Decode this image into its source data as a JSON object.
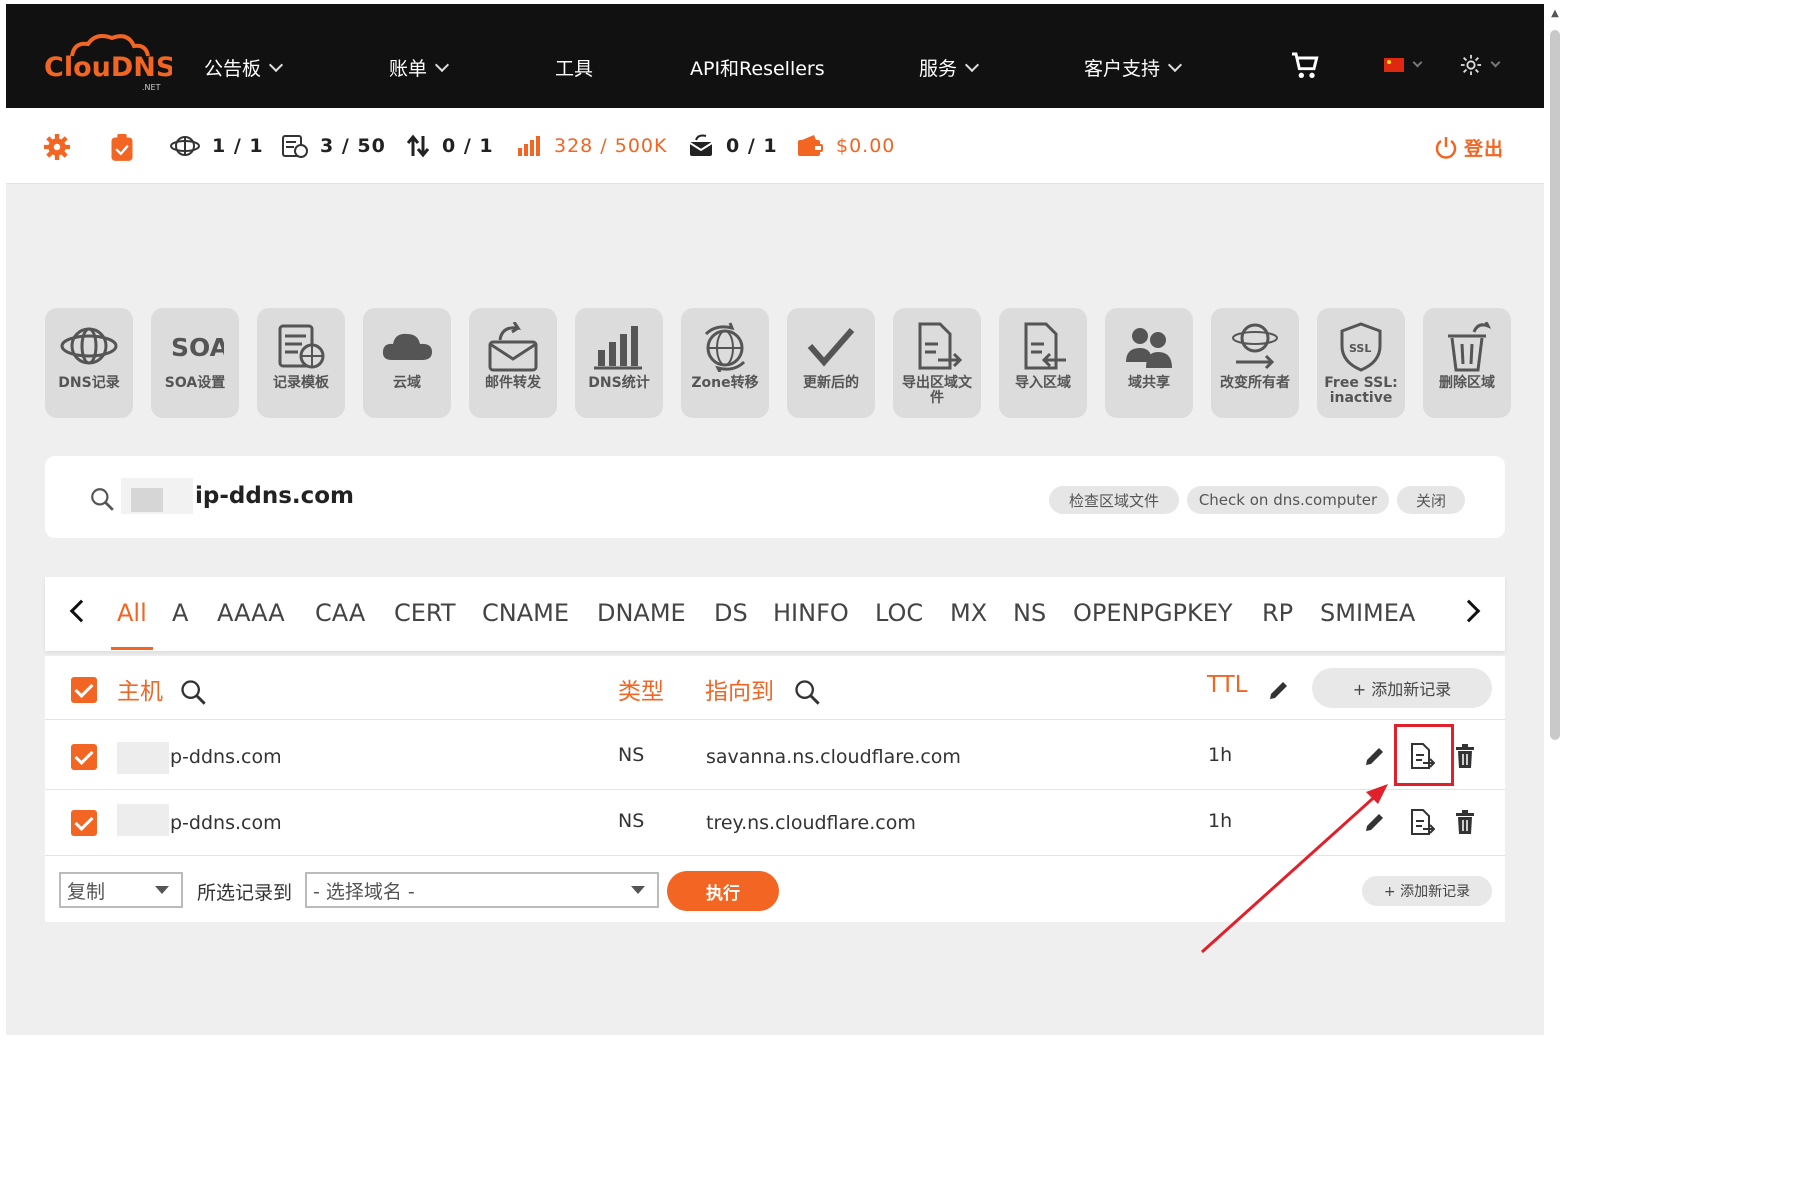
{
  "brand": {
    "name": "ClouDNS",
    "tld": ".NET"
  },
  "nav": {
    "items": [
      {
        "label": "公告板",
        "has_dropdown": true
      },
      {
        "label": "账单",
        "has_dropdown": true
      },
      {
        "label": "工具",
        "has_dropdown": false
      },
      {
        "label": "API和Resellers",
        "has_dropdown": false
      },
      {
        "label": "服务",
        "has_dropdown": true
      },
      {
        "label": "客户支持",
        "has_dropdown": true
      }
    ],
    "icons": [
      "cart-icon",
      "flag-cn-icon",
      "settings-sun-icon"
    ]
  },
  "stats": {
    "zones": "1 / 1",
    "records": "3 / 50",
    "transfers": "0 / 1",
    "queries": "328 / 500K",
    "mail": "0 / 1",
    "balance": "$0.00",
    "logout": "登出"
  },
  "tools": [
    {
      "label": "DNS记录",
      "icon": "globe-icon"
    },
    {
      "label": "SOA设置",
      "icon": "soa-icon"
    },
    {
      "label": "记录模板",
      "icon": "template-icon"
    },
    {
      "label": "云域",
      "icon": "cloud-icon"
    },
    {
      "label": "邮件转发",
      "icon": "mail-forward-icon"
    },
    {
      "label": "DNS统计",
      "icon": "bar-chart-icon"
    },
    {
      "label": "Zone转移",
      "icon": "zone-transfer-icon"
    },
    {
      "label": "更新后的",
      "icon": "check-icon"
    },
    {
      "label": "导出区域文件",
      "icon": "export-file-icon"
    },
    {
      "label": "导入区域",
      "icon": "import-file-icon"
    },
    {
      "label": "域共享",
      "icon": "users-icon"
    },
    {
      "label": "改变所有者",
      "icon": "change-owner-icon"
    },
    {
      "label": "Free SSL: inactive",
      "icon": "ssl-shield-icon"
    },
    {
      "label": "删除区域",
      "icon": "delete-bin-icon"
    }
  ],
  "domain": {
    "name": "ip-ddns.com",
    "actions": [
      "检查区域文件",
      "Check on dns.computer",
      "关闭"
    ]
  },
  "record_types": [
    "All",
    "A",
    "AAAA",
    "CAA",
    "CERT",
    "CNAME",
    "DNAME",
    "DS",
    "HINFO",
    "LOC",
    "MX",
    "NS",
    "OPENPGPKEY",
    "RP",
    "SMIMEA"
  ],
  "active_type": "All",
  "table": {
    "headers": {
      "host": "主机",
      "type": "类型",
      "points_to": "指向到",
      "ttl": "TTL"
    },
    "add_label": "+ 添加新记录",
    "rows": [
      {
        "host": "p-ddns.com",
        "type": "NS",
        "points_to": "savanna.ns.cloudflare.com",
        "ttl": "1h"
      },
      {
        "host": "p-ddns.com",
        "type": "NS",
        "points_to": "trey.ns.cloudflare.com",
        "ttl": "1h"
      }
    ]
  },
  "bulk": {
    "action_value": "复制",
    "to_label": "所选记录到",
    "target_placeholder": "- 选择域名 -",
    "run_label": "执行",
    "add_label": "+ 添加新记录"
  },
  "colors": {
    "accent": "#f26522",
    "nav_bg": "#111111",
    "highlight": "#e0202a"
  }
}
